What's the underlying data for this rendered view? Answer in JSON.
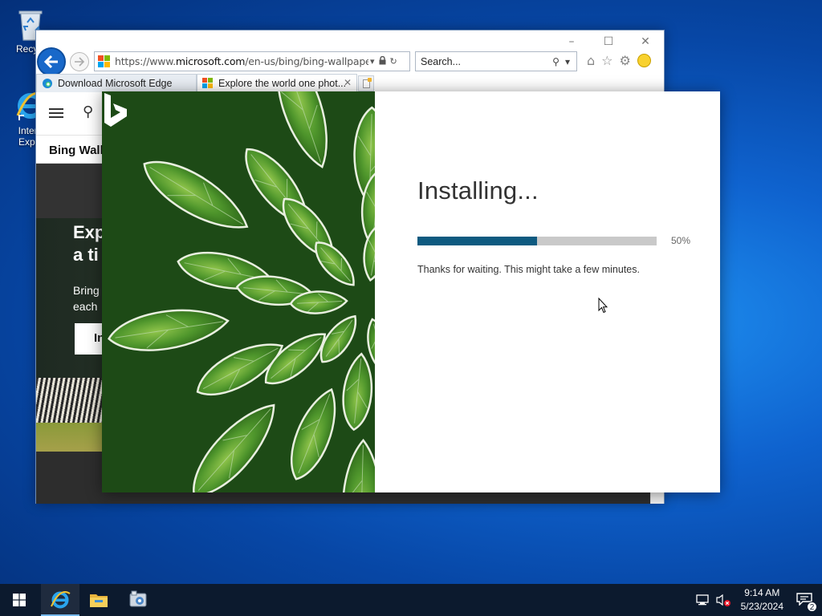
{
  "desktop": {
    "icons": [
      {
        "label": "Recycl"
      },
      {
        "label_line1": "Intern",
        "label_line2": "Explo"
      }
    ]
  },
  "ie": {
    "address": {
      "prefix": "https://www.",
      "domain": "microsoft.com",
      "path": "/en-us/bing/bing-wallpaper-m"
    },
    "search": {
      "placeholder": "Search..."
    },
    "tabs": [
      {
        "label": "Download Microsoft Edge"
      },
      {
        "label": "Explore the world one phot..."
      }
    ],
    "page": {
      "section_title": "Bing Wall",
      "hero_title_line1": "Exp",
      "hero_title_line2": "a ti",
      "hero_text_line1": "Bring",
      "hero_text_line2": "each",
      "hero_button": "In"
    }
  },
  "installer": {
    "title": "Installing...",
    "progress_value": 0.5,
    "progress_label": "50%",
    "message": "Thanks for waiting. This might take a few minutes.",
    "accent_color": "#0e5a80"
  },
  "taskbar": {
    "pinned": [
      "windows-start",
      "internet-explorer",
      "file-explorer",
      "setup-app"
    ],
    "clock_time": "9:14 AM",
    "clock_date": "5/23/2024",
    "notification_count": "2"
  }
}
